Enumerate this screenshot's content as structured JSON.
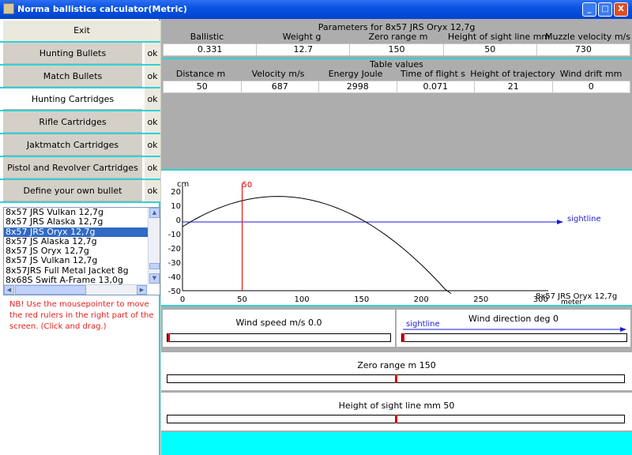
{
  "window": {
    "title": "Norma ballistics calculator(Metric)",
    "buttons": {
      "minimize": "_",
      "maximize": "□",
      "close": "X"
    }
  },
  "nav": {
    "exit_label": "Exit",
    "items": [
      {
        "label": "Hunting Bullets",
        "ok": "ok"
      },
      {
        "label": "Match Bullets",
        "ok": "ok"
      },
      {
        "label": "Hunting Cartridges",
        "ok": "ok",
        "active": true
      },
      {
        "label": "Rifle Cartridges",
        "ok": "ok"
      },
      {
        "label": "Jaktmatch Cartridges",
        "ok": "ok"
      },
      {
        "label": "Pistol and Revolver Cartridges",
        "ok": "ok"
      },
      {
        "label": "Define your own bullet",
        "ok": "ok"
      }
    ]
  },
  "cartridge_list": {
    "items": [
      "8x57 JRS Vulkan 12,7g",
      "8x57 JRS Alaska 12,7g",
      "8x57 JRS Oryx 12,7g",
      "8x57 JS Alaska 12,7g",
      "8x57 JS Oryx 12,7g",
      "8x57 JS Vulkan 12,7g",
      "8x57JRS Full Metal Jacket 8g",
      "8x68S Swift A-Frame 13,0g"
    ],
    "selected_index": 2
  },
  "note": "NB! Use the mousepointer to move the red rulers in the right part of the screen. (Click and drag.)",
  "parameters": {
    "title": "Parameters for 8x57 JRS Oryx 12,7g",
    "headers": [
      "Ballistic coefficient",
      "Weight g",
      "Zero range m",
      "Height of sight line mm",
      "Muzzle velocity m/s"
    ],
    "values": [
      "0.331",
      "12.7",
      "150",
      "50",
      "730"
    ]
  },
  "table": {
    "title": "Table values",
    "headers": [
      "Distance m",
      "Velocity m/s",
      "Energy Joule",
      "Time of flight s",
      "Height of trajectory mm",
      "Wind drift mm"
    ],
    "values": [
      "50",
      "687",
      "2998",
      "0.071",
      "21",
      "0"
    ]
  },
  "trajectory_chart": {
    "y_unit": "cm",
    "x_unit": "meter",
    "y_ticks": [
      "20",
      "10",
      "0",
      "-10",
      "-20",
      "-30",
      "-40",
      "-50"
    ],
    "x_ticks": [
      "0",
      "50",
      "100",
      "150",
      "200",
      "250",
      "300"
    ],
    "sightline_label": "sightline",
    "ruler_label": "50",
    "cartridge_label": "8x57 JRS Oryx 12,7g",
    "ruler_distance_m": 50
  },
  "wind_speed": {
    "label": "Wind speed m/s 0.0",
    "level": 0.0
  },
  "wind_direction": {
    "label": "Wind direction deg 0",
    "sightline_label": "sightline",
    "level": 0.0
  },
  "zero_range": {
    "label": "Zero range m 150",
    "level": 0.5
  },
  "sight_height": {
    "label": "Height of sight line mm 50",
    "level": 0.5
  },
  "colors": {
    "accent_cyan": "#2fd2d6",
    "ruler_red": "#d40000",
    "sightline_blue": "#1a1ae0",
    "selection_blue": "#316ac5"
  }
}
